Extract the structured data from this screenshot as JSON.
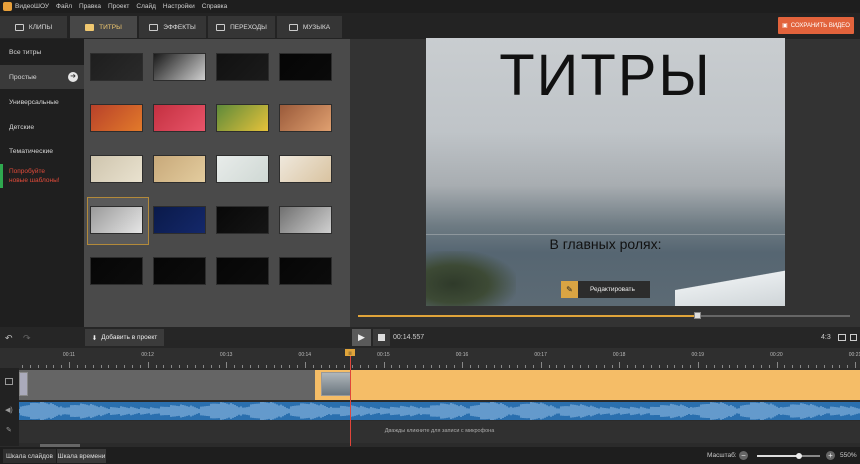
{
  "app": {
    "name": "ВидеоШОУ"
  },
  "menu": [
    "Файл",
    "Правка",
    "Проект",
    "Слайд",
    "Настройки",
    "Справка"
  ],
  "tabs": [
    {
      "label": "КЛИПЫ",
      "icon": "film-icon"
    },
    {
      "label": "ТИТРЫ",
      "icon": "titles-icon",
      "active": true
    },
    {
      "label": "ЭФФЕКТЫ",
      "icon": "effects-icon"
    },
    {
      "label": "ПЕРЕХОДЫ",
      "icon": "transitions-icon"
    },
    {
      "label": "МУЗЫКА",
      "icon": "music-note-icon"
    }
  ],
  "save_button": "СОХРАНИТЬ ВИДЕО",
  "categories": [
    {
      "label": "Все титры"
    },
    {
      "label": "Простые",
      "active": true
    },
    {
      "label": "Универсальные"
    },
    {
      "label": "Детские"
    },
    {
      "label": "Тематические"
    }
  ],
  "promo": {
    "line1": "Попробуйте",
    "line2": "новые шаблоны!"
  },
  "preview": {
    "title": "ТИТРЫ",
    "subtitle": "В главных ролях:",
    "edit_button": "Редактировать"
  },
  "add_button": "Добавить в проект",
  "playback": {
    "timecode": "00:14.557",
    "aspect": "4:3",
    "progress": 0.69
  },
  "timeline": {
    "ruler": [
      "00:11",
      "00:12",
      "00:13",
      "00:14",
      "00:15",
      "00:16",
      "00:17",
      "00:18",
      "00:19",
      "00:20",
      "00:21"
    ],
    "mic_hint": "Дважды кликните для записи с микрофона"
  },
  "bottom": {
    "tab_slides": "Шкала слайдов",
    "tab_timeline": "Шкала времени",
    "zoom_label": "Масштаб:",
    "zoom_value": "550%",
    "zoom_level": 0.66
  },
  "colors": {
    "accent": "#e0a43a",
    "save": "#e2633c",
    "promo": "#e24b3a",
    "audio": "#2a6fae"
  }
}
